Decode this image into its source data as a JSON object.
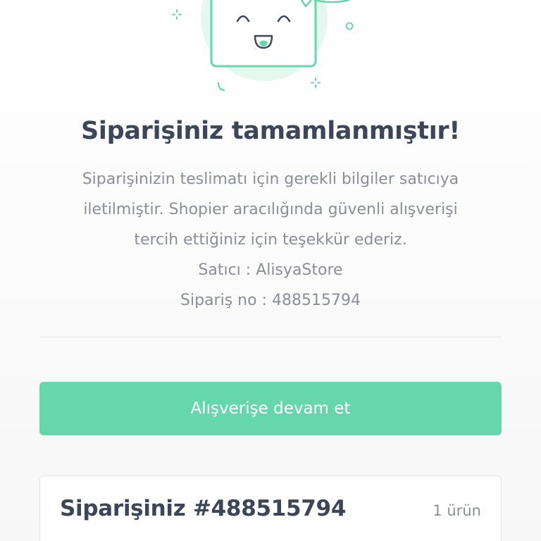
{
  "theme": {
    "accent": "#66d6ad",
    "accent_light": "#e6f7f0",
    "heading_color": "#3d4658",
    "text_color": "#8a8e98"
  },
  "illustration": {
    "icon": "happy-box-illustration"
  },
  "confirmation": {
    "title": "Siparişiniz tamamlanmıştır!",
    "message_line1": "Siparişinizin teslimatı için gerekli bilgiler satıcıya",
    "message_line2": "iletilmiştir. Shopier aracılığında güvenli alışverişi",
    "message_line3": "tercih ettiğiniz için teşekkür ederiz.",
    "seller": "Satıcı : AlisyaStore",
    "order_number": "Sipariş no : 488515794"
  },
  "actions": {
    "continue_label": "Alışverişe devam et"
  },
  "order_summary": {
    "title": "Siparişiniz #488515794",
    "item_count": "1 ürün"
  }
}
